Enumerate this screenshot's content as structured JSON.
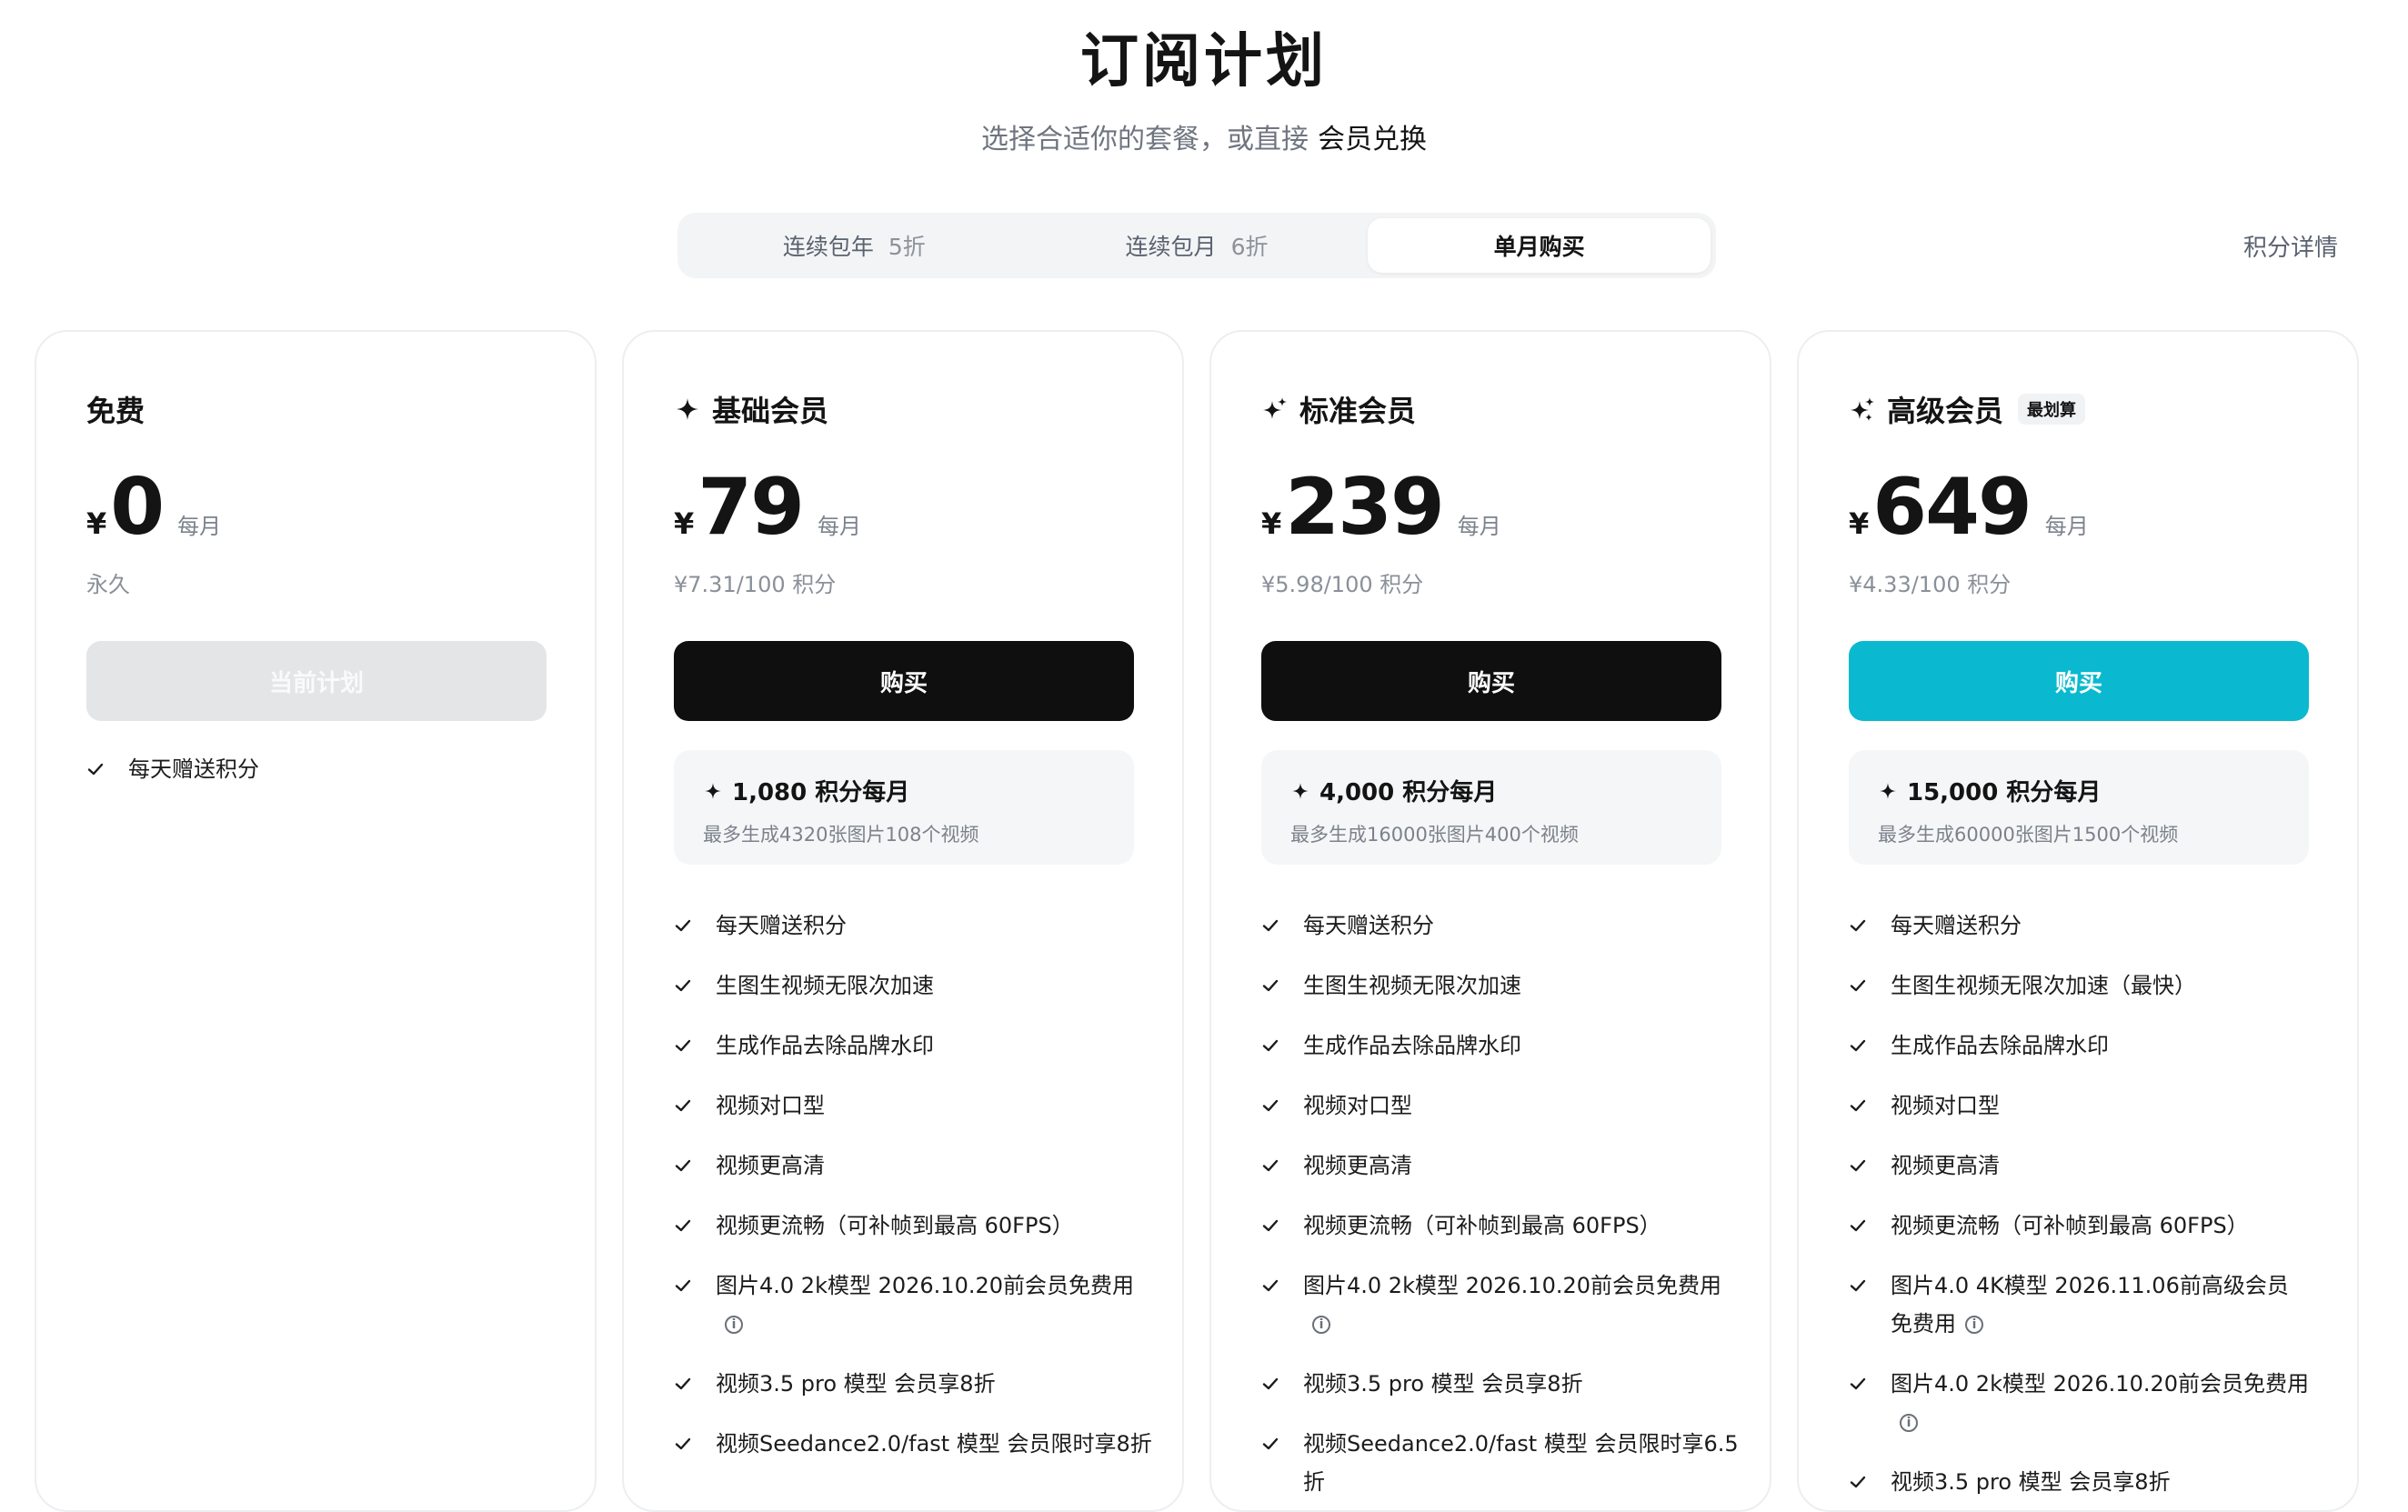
{
  "header": {
    "title": "订阅计划",
    "subtitle": "选择合适你的套餐，或直接",
    "redeem_link": "会员兑换"
  },
  "tabs": [
    {
      "label": "连续包年",
      "discount": "5折",
      "active": false
    },
    {
      "label": "连续包月",
      "discount": "6折",
      "active": false
    },
    {
      "label": "单月购买",
      "discount": "",
      "active": true
    }
  ],
  "credits_detail_link": "积分详情",
  "colors": {
    "accent_teal": "#0ab9cf",
    "dark_button": "#0f0f10",
    "disabled_button": "#e4e5e7"
  },
  "plans": [
    {
      "name": "免费",
      "icon": "",
      "currency": "¥",
      "price": "0",
      "period": "每月",
      "sub_price": "永久",
      "button": "当前计划",
      "features": [
        "每天赠送积分"
      ]
    },
    {
      "name": "基础会员",
      "icon": "sparkle-icon",
      "currency": "¥",
      "price": "79",
      "period": "每月",
      "sub_price": "¥7.31/100 积分",
      "button": "购买",
      "credits": {
        "title": "1,080 积分每月",
        "sub": "最多生成4320张图片108个视频"
      },
      "features": [
        "每天赠送积分",
        "生图生视频无限次加速",
        "生成作品去除品牌水印",
        "视频对口型",
        "视频更高清",
        "视频更流畅（可补帧到最高 60FPS）",
        "图片4.0 2k模型 2026.10.20前会员免费用",
        "视频3.5 pro 模型 会员享8折",
        "视频Seedance2.0/fast 模型 会员限时享8折"
      ]
    },
    {
      "name": "标准会员",
      "icon": "sparkles-icon",
      "currency": "¥",
      "price": "239",
      "period": "每月",
      "sub_price": "¥5.98/100 积分",
      "button": "购买",
      "credits": {
        "title": "4,000 积分每月",
        "sub": "最多生成16000张图片400个视频"
      },
      "features": [
        "每天赠送积分",
        "生图生视频无限次加速",
        "生成作品去除品牌水印",
        "视频对口型",
        "视频更高清",
        "视频更流畅（可补帧到最高 60FPS）",
        "图片4.0 2k模型 2026.10.20前会员免费用",
        "视频3.5 pro 模型 会员享8折",
        "视频Seedance2.0/fast 模型 会员限时享6.5折"
      ]
    },
    {
      "name": "高级会员",
      "icon": "sparkles-icon",
      "badge": "最划算",
      "currency": "¥",
      "price": "649",
      "period": "每月",
      "sub_price": "¥4.33/100 积分",
      "button": "购买",
      "credits": {
        "title": "15,000 积分每月",
        "sub": "最多生成60000张图片1500个视频"
      },
      "features": [
        "每天赠送积分",
        "生图生视频无限次加速（最快）",
        "生成作品去除品牌水印",
        "视频对口型",
        "视频更高清",
        "视频更流畅（可补帧到最高 60FPS）",
        "图片4.0 4K模型 2026.11.06前高级会员免费用",
        "图片4.0 2k模型 2026.10.20前会员免费用",
        "视频3.5 pro 模型 会员享8折"
      ]
    }
  ]
}
